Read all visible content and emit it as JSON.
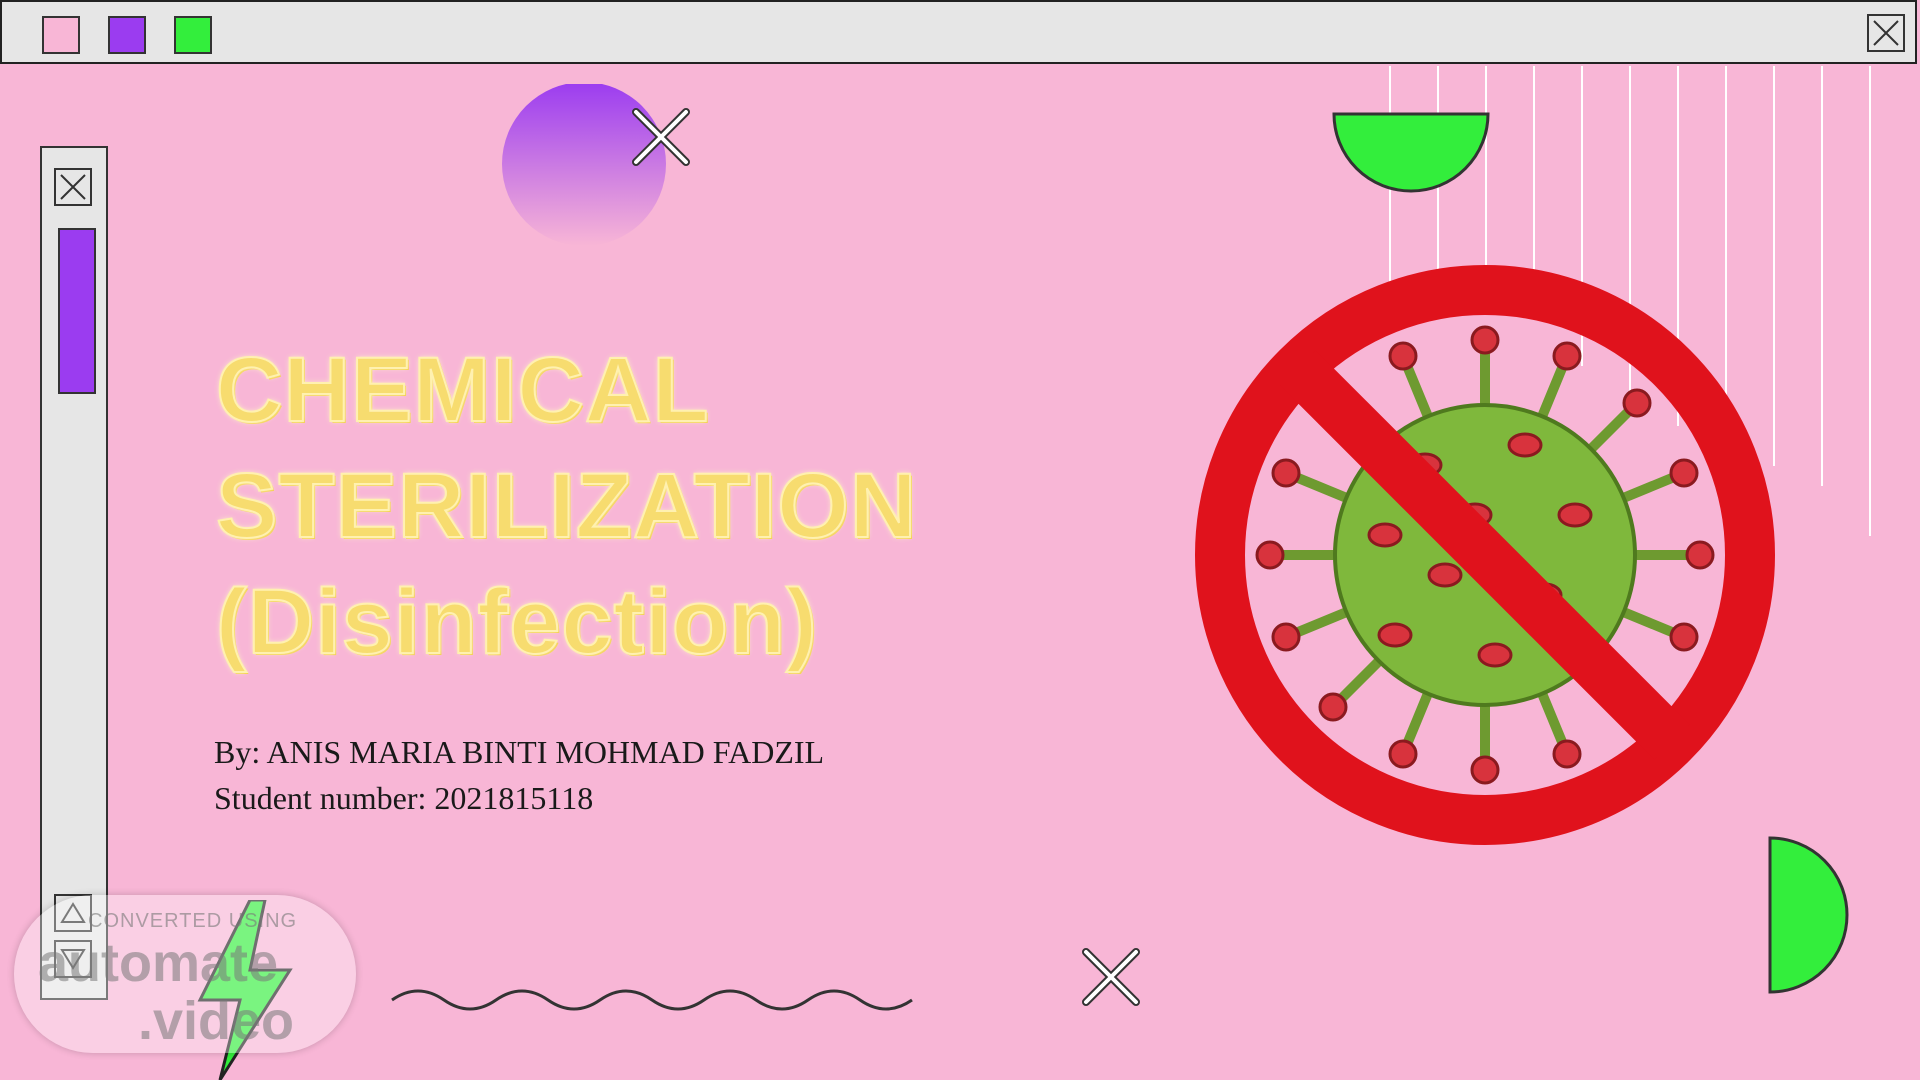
{
  "window": {
    "swatches": [
      {
        "name": "pink-swatch",
        "color": "#f8b6d6"
      },
      {
        "name": "purple-swatch",
        "color": "#9b3cf0"
      },
      {
        "name": "green-swatch",
        "color": "#33ee3c"
      }
    ],
    "close_icon": "close-icon"
  },
  "scrollbar": {
    "close_icon": "close-icon",
    "up_icon": "triangle-up-icon",
    "down_icon": "triangle-down-icon",
    "thumb_color": "#9b3cf0"
  },
  "slide": {
    "title_lines": [
      "CHEMICAL",
      "STERILIZATION",
      "(Disinfection)"
    ],
    "author_line": "By: ANIS MARIA BINTI MOHMAD FADZIL",
    "student_line": "Student number: 2021815118",
    "illustration_icon": "no-virus-icon"
  },
  "watermark": {
    "small": "CONVERTED USING",
    "big1": "automate",
    "big2": ".video"
  },
  "colors": {
    "background": "#f8b6d6",
    "accent_purple": "#9b3cf0",
    "accent_green": "#33ee3c",
    "title_yellow": "#f7dc6f",
    "prohibit_red": "#e0121c",
    "virus_green": "#7fb83c"
  }
}
